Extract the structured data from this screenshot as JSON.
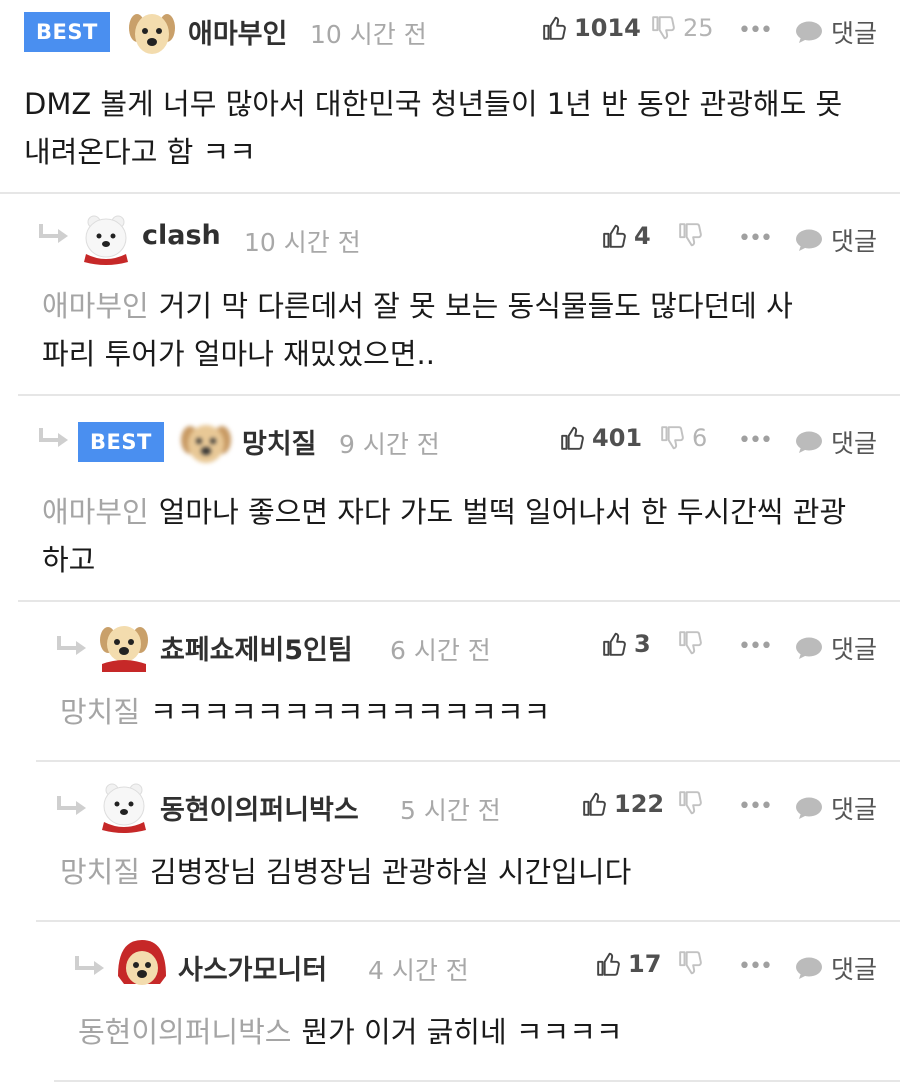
{
  "comments": [
    {
      "best_label": "BEST",
      "avatar": "puppy",
      "nick": "애마부인",
      "time": "10 시간 전",
      "likes": "1014",
      "dislikes": "25",
      "more": "•••",
      "reply_label": "댓글",
      "mention": "",
      "text": "DMZ 볼게 너무 많아서 대한민국 청년들이 1년 반 동안 관광해도 못 내려온다고 함 ㅋㅋ"
    },
    {
      "avatar": "polar-bear",
      "nick": "clash",
      "time": "10 시간 전",
      "likes": "4",
      "dislikes": "",
      "more": "•••",
      "reply_label": "댓글",
      "mention": "애마부인",
      "text": "거기 막 다른데서 잘 못 보는 동식물들도 많다던데 사파리 투어가 얼마나 재밌었으면.."
    },
    {
      "best_label": "BEST",
      "avatar": "blurred-puppy",
      "nick": "망치질",
      "time": "9 시간 전",
      "likes": "401",
      "dislikes": "6",
      "more": "•••",
      "reply_label": "댓글",
      "mention": "애마부인",
      "text": "얼마나 좋으면 자다 가도 벌떡 일어나서 한 두시간씩 관광 하고"
    },
    {
      "avatar": "puppy-scarf",
      "nick": "쵸페쇼제비5인팀",
      "time": "6 시간 전",
      "likes": "3",
      "dislikes": "",
      "more": "•••",
      "reply_label": "댓글",
      "mention": "망치질",
      "text": "ㅋㅋㅋㅋㅋㅋㅋㅋㅋㅋㅋㅋㅋㅋㅋ"
    },
    {
      "avatar": "polar-bear",
      "nick": "동현이의퍼니박스",
      "time": "5 시간 전",
      "likes": "122",
      "dislikes": "",
      "more": "•••",
      "reply_label": "댓글",
      "mention": "망치질",
      "text": "김병장님 김병장님 관광하실 시간입니다"
    },
    {
      "avatar": "puppy-hood",
      "nick": "사스가모니터",
      "time": "4 시간 전",
      "likes": "17",
      "dislikes": "",
      "more": "•••",
      "reply_label": "댓글",
      "mention": "동현이의퍼니박스",
      "text": "뭔가 이거 긁히네 ㅋㅋㅋㅋ"
    }
  ]
}
